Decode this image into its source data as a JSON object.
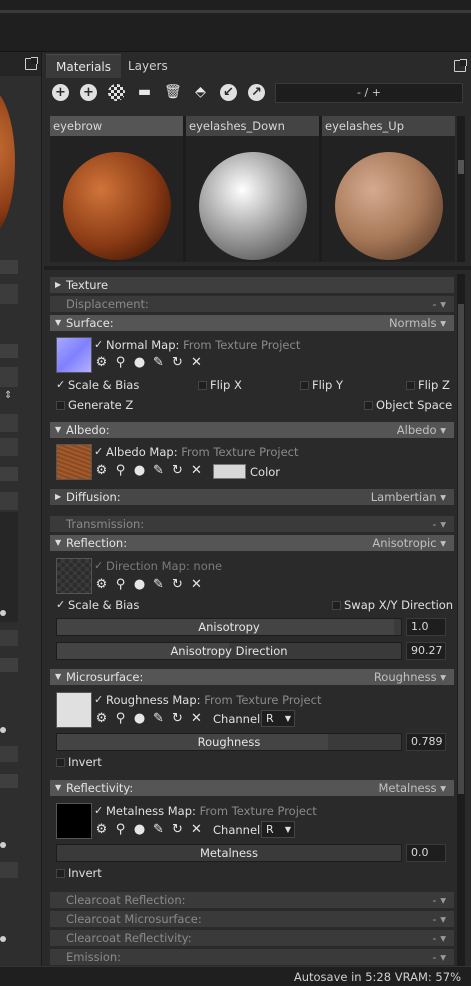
{
  "tabs": [
    {
      "label": "Materials",
      "active": true
    },
    {
      "label": "Layers",
      "active": false
    }
  ],
  "toolbar": {
    "icons": [
      "add-material-icon",
      "duplicate-material-icon",
      "checker-icon",
      "folder-icon",
      "trash-icon",
      "import-icon",
      "export-icon",
      "link-icon"
    ],
    "pager": "- / +"
  },
  "thumbnails": [
    {
      "label": "eyebrow",
      "selected": true,
      "color": "#8a3a14"
    },
    {
      "label": "eyelashes_Down",
      "selected": false,
      "color": "#9c9c9c"
    },
    {
      "label": "eyelashes_Up",
      "selected": false,
      "color": "#a77858"
    }
  ],
  "sections": {
    "texture": {
      "name": "Texture"
    },
    "displacement": {
      "name": "Displacement:",
      "mode": "-"
    },
    "surface": {
      "name": "Surface:",
      "mode": "Normals",
      "map_name": "Normal Map:",
      "map_source": "From Texture Project",
      "scale_bias": "Scale & Bias",
      "flip_x": "Flip X",
      "flip_y": "Flip Y",
      "flip_z": "Flip Z",
      "generate_z": "Generate Z",
      "object_space": "Object Space"
    },
    "albedo": {
      "name": "Albedo:",
      "mode": "Albedo",
      "map_name": "Albedo Map:",
      "map_source": "From Texture Project",
      "color_label": "Color"
    },
    "diffusion": {
      "name": "Diffusion:",
      "mode": "Lambertian"
    },
    "transmission": {
      "name": "Transmission:",
      "mode": "-"
    },
    "reflection": {
      "name": "Reflection:",
      "mode": "Anisotropic",
      "map_name": "Direction Map:",
      "map_source": "none",
      "scale_bias": "Scale & Bias",
      "swap_xy": "Swap X/Y Direction",
      "anisotropy_label": "Anisotropy",
      "anisotropy_value": "1.0",
      "anisotropy_fraction": 0.98,
      "direction_label": "Anisotropy Direction",
      "direction_value": "90.27",
      "direction_fraction": 0.5
    },
    "microsurface": {
      "name": "Microsurface:",
      "mode": "Roughness",
      "map_name": "Roughness Map:",
      "map_source": "From Texture Project",
      "channel_label": "Channel",
      "channel_value": "R",
      "roughness_label": "Roughness",
      "roughness_value": "0.789",
      "roughness_fraction": 0.789,
      "invert_label": "Invert"
    },
    "reflectivity": {
      "name": "Reflectivity:",
      "mode": "Metalness",
      "map_name": "Metalness Map:",
      "map_source": "From Texture Project",
      "channel_label": "Channel",
      "channel_value": "R",
      "metalness_label": "Metalness",
      "metalness_value": "0.0",
      "metalness_fraction": 0.0,
      "invert_label": "Invert"
    },
    "clearcoat_reflection": {
      "name": "Clearcoat Reflection:",
      "mode": "-"
    },
    "clearcoat_microsurface": {
      "name": "Clearcoat Microsurface:",
      "mode": "-"
    },
    "clearcoat_reflectivity": {
      "name": "Clearcoat Reflectivity:",
      "mode": "-"
    },
    "emission": {
      "name": "Emission:",
      "mode": "-"
    }
  },
  "status": {
    "text": "Autosave in 5:28   VRAM: 57%"
  }
}
